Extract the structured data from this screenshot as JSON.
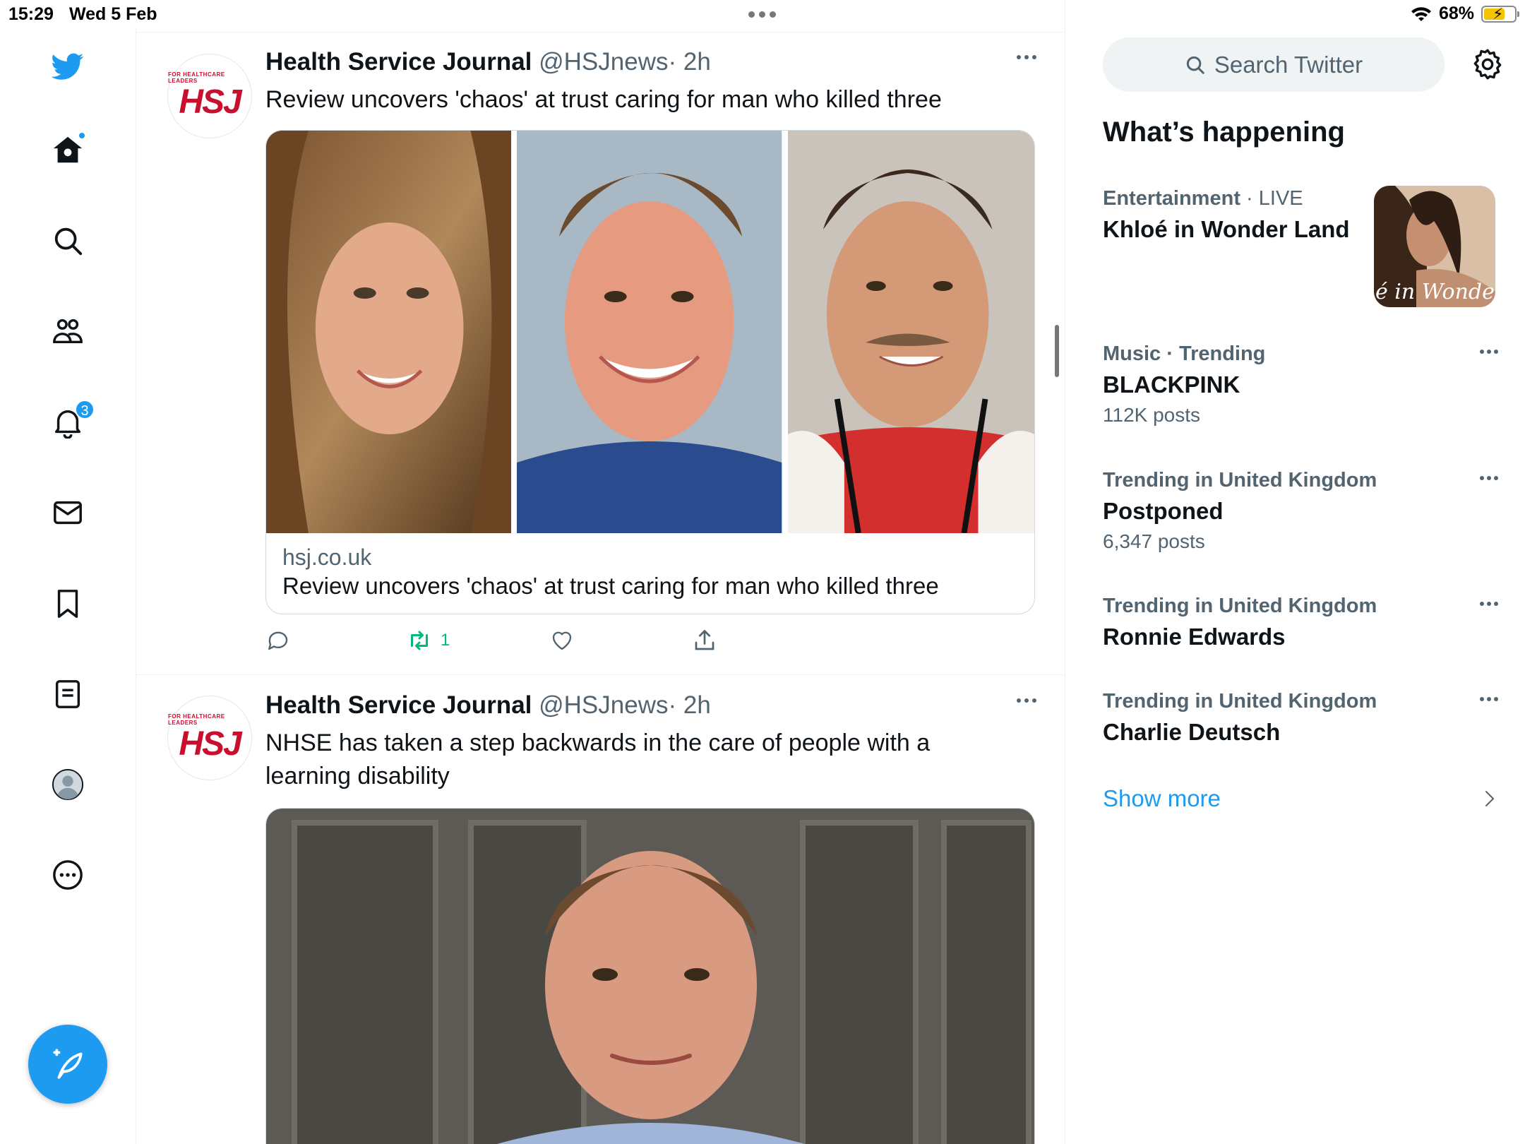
{
  "status_bar": {
    "time": "15:29",
    "date": "Wed 5 Feb",
    "battery": "68%",
    "battery_level": 0.68
  },
  "nav": {
    "items": [
      {
        "name": "home",
        "icon": "home-icon",
        "has_dot": true
      },
      {
        "name": "explore",
        "icon": "search-icon"
      },
      {
        "name": "communities",
        "icon": "people-icon"
      },
      {
        "name": "notifications",
        "icon": "bell-icon",
        "badge": "3"
      },
      {
        "name": "messages",
        "icon": "mail-icon"
      },
      {
        "name": "bookmarks",
        "icon": "bookmark-icon"
      },
      {
        "name": "lists",
        "icon": "list-icon"
      },
      {
        "name": "profile",
        "icon": "avatar-icon"
      },
      {
        "name": "more",
        "icon": "more-circle-icon"
      }
    ],
    "compose_icon": "compose-feather-icon"
  },
  "tweets": [
    {
      "name": "Health Service Journal",
      "handle": "@HSJnews",
      "time": "· 2h",
      "text": "Review uncovers 'chaos' at trust caring for man who killed three",
      "avatar_small": "FOR HEALTHCARE LEADERS",
      "avatar_big": "HSJ",
      "card": {
        "domain": "hsj.co.uk",
        "title": "Review uncovers 'chaos' at trust caring for man who killed three"
      },
      "retweets": "1"
    },
    {
      "name": "Health Service Journal",
      "handle": "@HSJnews",
      "time": "· 2h",
      "text": "NHSE has taken a step backwards in the care of people with a learning disability",
      "avatar_small": "FOR HEALTHCARE LEADERS",
      "avatar_big": "HSJ"
    }
  ],
  "sidebar": {
    "search_placeholder": "Search Twitter",
    "whats_happening": "What’s happening",
    "trends": [
      {
        "category": "Entertainment",
        "sep": " · ",
        "context": "LIVE",
        "title": "Khloé in Wonder Land",
        "count": "",
        "thumb_text": "é in Wonder L"
      },
      {
        "category": "Music · Trending",
        "title": "BLACKPINK",
        "count": "112K posts"
      },
      {
        "category": "Trending in United Kingdom",
        "title": "Postponed",
        "count": "6,347 posts"
      },
      {
        "category": "Trending in United Kingdom",
        "title": "Ronnie Edwards",
        "count": ""
      },
      {
        "category": "Trending in United Kingdom",
        "title": "Charlie Deutsch",
        "count": ""
      }
    ],
    "show_more": "Show more"
  },
  "colors": {
    "accent": "#1d9bf0",
    "text_primary": "#0f1419",
    "text_secondary": "#536471",
    "retweet_green": "#00ba7c",
    "hsj_red": "#c8102e"
  }
}
